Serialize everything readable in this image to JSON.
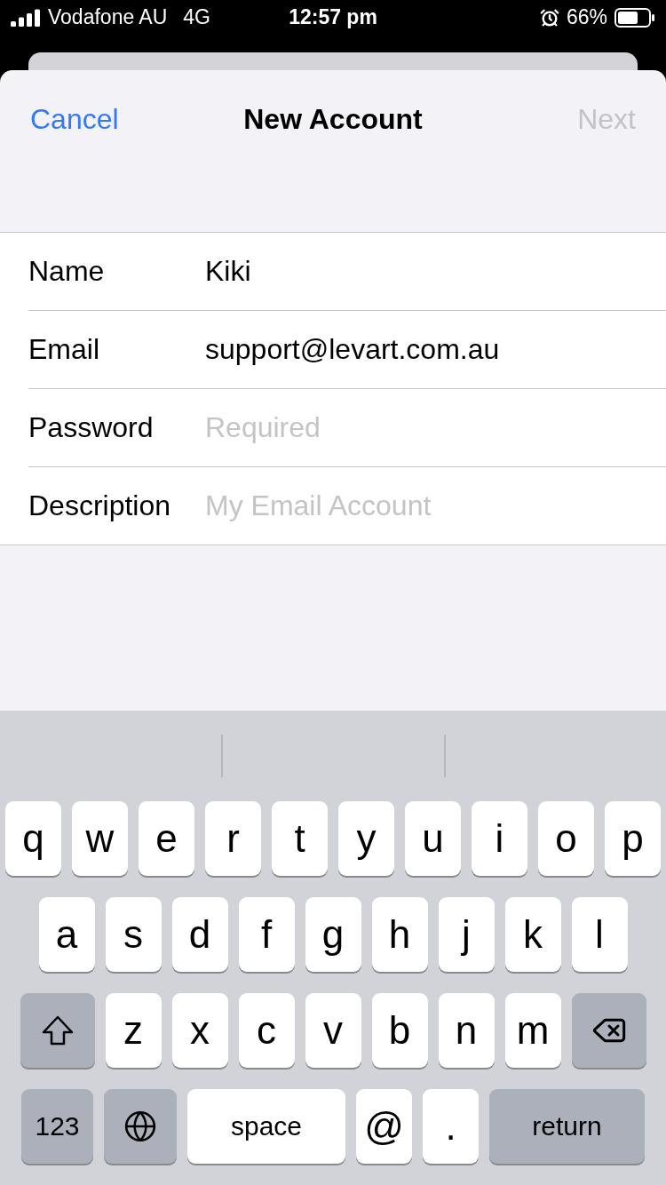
{
  "status_bar": {
    "carrier": "Vodafone AU",
    "network": "4G",
    "time": "12:57 pm",
    "battery": "66%"
  },
  "nav": {
    "cancel": "Cancel",
    "title": "New Account",
    "next": {
      "label": "Next",
      "disabled": true
    }
  },
  "fields": [
    {
      "label": "Name",
      "value": "Kiki"
    },
    {
      "label": "Email",
      "value": "support@levart.com.au"
    },
    {
      "label": "Password",
      "placeholder": "Required"
    },
    {
      "label": "Description",
      "placeholder": "My Email Account"
    }
  ],
  "keyboard": {
    "rows": [
      {
        "keys": [
          {
            "kind": "letter",
            "label": "q"
          },
          {
            "kind": "letter",
            "label": "w"
          },
          {
            "kind": "letter",
            "label": "e"
          },
          {
            "kind": "letter",
            "label": "r"
          },
          {
            "kind": "letter",
            "label": "t"
          },
          {
            "kind": "letter",
            "label": "y"
          },
          {
            "kind": "letter",
            "label": "u"
          },
          {
            "kind": "letter",
            "label": "i"
          },
          {
            "kind": "letter",
            "label": "o"
          },
          {
            "kind": "letter",
            "label": "p"
          }
        ]
      },
      {
        "keys": [
          {
            "kind": "letter",
            "label": "a"
          },
          {
            "kind": "letter",
            "label": "s"
          },
          {
            "kind": "letter",
            "label": "d"
          },
          {
            "kind": "letter",
            "label": "f"
          },
          {
            "kind": "letter",
            "label": "g"
          },
          {
            "kind": "letter",
            "label": "h"
          },
          {
            "kind": "letter",
            "label": "j"
          },
          {
            "kind": "letter",
            "label": "k"
          },
          {
            "kind": "letter",
            "label": "l"
          }
        ]
      },
      {
        "keys": [
          {
            "kind": "shift"
          },
          {
            "kind": "letter",
            "label": "z"
          },
          {
            "kind": "letter",
            "label": "x"
          },
          {
            "kind": "letter",
            "label": "c"
          },
          {
            "kind": "letter",
            "label": "v"
          },
          {
            "kind": "letter",
            "label": "b"
          },
          {
            "kind": "letter",
            "label": "n"
          },
          {
            "kind": "letter",
            "label": "m"
          },
          {
            "kind": "delete"
          }
        ]
      },
      {
        "keys": [
          {
            "kind": "mode",
            "label": "123"
          },
          {
            "kind": "globe"
          },
          {
            "kind": "space",
            "label": "space"
          },
          {
            "kind": "letter",
            "label": "@"
          },
          {
            "kind": "letter",
            "label": "."
          },
          {
            "kind": "return",
            "label": "return"
          }
        ]
      }
    ]
  }
}
